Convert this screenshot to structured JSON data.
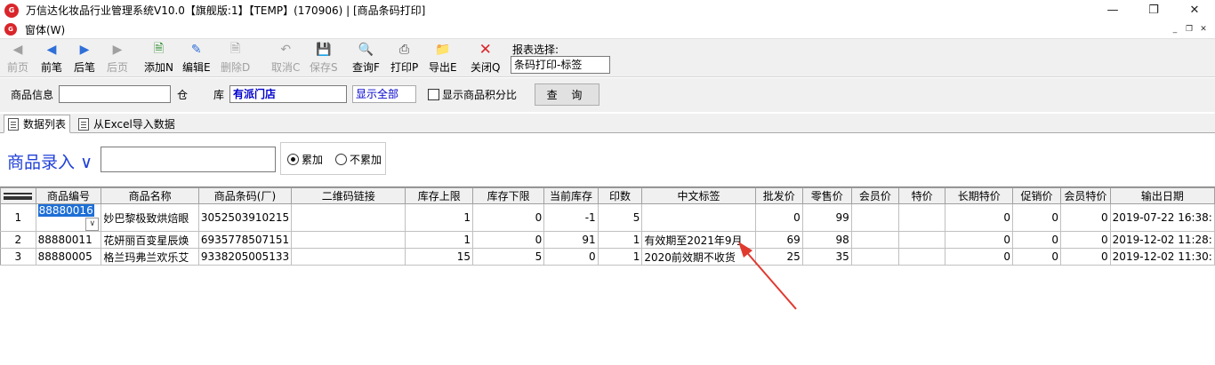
{
  "window": {
    "title": "万信达化妆品行业管理系统V10.0【旗舰版:1】【TEMP】(170906) | [商品条码打印]",
    "logo_text": "G"
  },
  "menu": {
    "items": [
      "窗体(W)"
    ]
  },
  "toolbar": {
    "buttons": [
      {
        "label": "前页",
        "icon": "first-page-icon"
      },
      {
        "label": "前笔",
        "icon": "prev-icon"
      },
      {
        "label": "后笔",
        "icon": "next-icon"
      },
      {
        "label": "后页",
        "icon": "last-page-icon"
      },
      {
        "label": "添加N",
        "icon": "add-icon"
      },
      {
        "label": "编辑E",
        "icon": "edit-icon"
      },
      {
        "label": "删除D",
        "icon": "delete-icon"
      },
      {
        "label": "取消C",
        "icon": "undo-icon"
      },
      {
        "label": "保存S",
        "icon": "save-icon"
      },
      {
        "label": "查询F",
        "icon": "search-icon"
      },
      {
        "label": "打印P",
        "icon": "print-icon"
      },
      {
        "label": "导出E",
        "icon": "export-icon"
      },
      {
        "label": "关闭Q",
        "icon": "close-icon"
      }
    ],
    "report_label": "报表选择:",
    "report_value": "条码打印-标签"
  },
  "filter": {
    "product_info_label": "商品信息",
    "product_info_value": "",
    "warehouse_label": "仓",
    "store_label": "库",
    "store_value": "有派门店",
    "display_option": "显示全部",
    "show_points_label": "显示商品积分比",
    "query_button": "查 询"
  },
  "tabs": {
    "items": [
      {
        "label": "数据列表"
      },
      {
        "label": "从Excel导入数据"
      }
    ]
  },
  "entry": {
    "label": "商品录入",
    "chevron": "∨",
    "input_value": "",
    "radio_accumulate": "累加",
    "radio_no_accumulate": "不累加"
  },
  "grid": {
    "columns": [
      "商品编号",
      "商品名称",
      "商品条码(厂)",
      "二维码链接",
      "库存上限",
      "库存下限",
      "当前库存",
      "印数",
      "中文标签",
      "批发价",
      "零售价",
      "会员价",
      "特价",
      "长期特价",
      "促销价",
      "会员特价",
      "输出日期"
    ],
    "rows": [
      {
        "row": "1",
        "code": "88880016",
        "name": "妙巴黎极致烘焙眼",
        "barcode": "3052503910215",
        "qr": "",
        "max": "1",
        "min": "0",
        "stock": "-1",
        "prints": "5",
        "label": "",
        "wholesale": "0",
        "retail": "99",
        "member": "",
        "special": "",
        "long_special": "0",
        "promo": "0",
        "member_special": "0",
        "date": "2019-07-22 16:38:"
      },
      {
        "row": "2",
        "code": "88880011",
        "name": "花妍丽百变星辰焕",
        "barcode": "6935778507151",
        "qr": "",
        "max": "1",
        "min": "0",
        "stock": "91",
        "prints": "1",
        "label": "有效期至2021年9月",
        "wholesale": "69",
        "retail": "98",
        "member": "",
        "special": "",
        "long_special": "0",
        "promo": "0",
        "member_special": "0",
        "date": "2019-12-02 11:28:"
      },
      {
        "row": "3",
        "code": "88880005",
        "name": "格兰玛弗兰欢乐艾",
        "barcode": "9338205005133",
        "qr": "",
        "max": "15",
        "min": "5",
        "stock": "0",
        "prints": "1",
        "label": "2020前效期不收货",
        "wholesale": "25",
        "retail": "35",
        "member": "",
        "special": "",
        "long_special": "0",
        "promo": "0",
        "member_special": "0",
        "date": "2019-12-02 11:30:"
      }
    ]
  },
  "colors": {
    "accent_blue": "#1f3fd8",
    "selection": "#1e6fd6",
    "annotation_red": "#e03a2f",
    "logo_red": "#d9262b"
  }
}
